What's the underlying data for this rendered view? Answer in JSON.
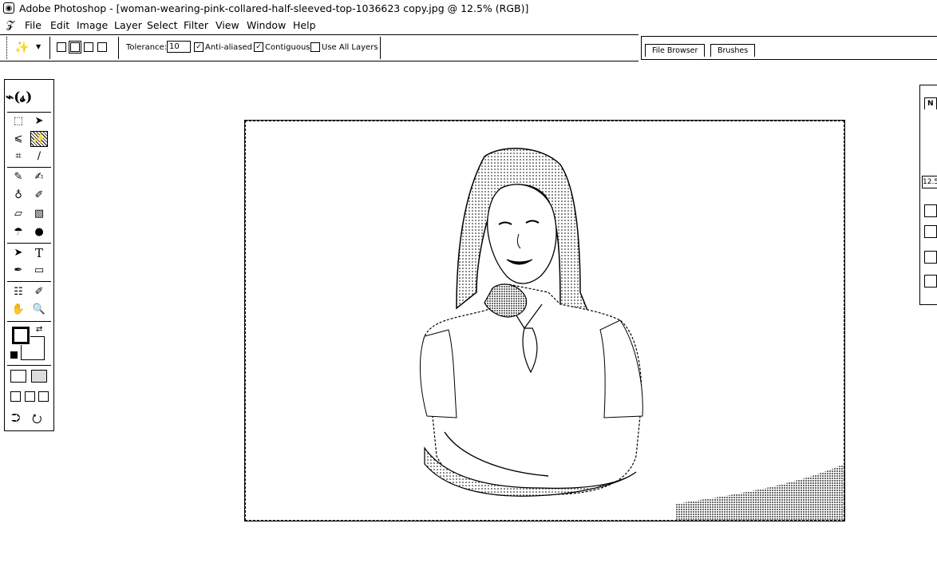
{
  "window": {
    "app_icon": "photoshop-app-icon",
    "title": "Adobe Photoshop - [woman-wearing-pink-collared-half-sleeved-top-1036623 copy.jpg @ 12.5% (RGB)]"
  },
  "menu": {
    "items": [
      "File",
      "Edit",
      "Image",
      "Layer",
      "Select",
      "Filter",
      "View",
      "Window",
      "Help"
    ]
  },
  "options_bar": {
    "tool_icon": "magic-wand-icon",
    "selection_modes": [
      "new-selection-icon",
      "add-to-selection-icon",
      "subtract-from-selection-icon",
      "intersect-selection-icon"
    ],
    "tolerance_label": "Tolerance:",
    "tolerance_value": "10",
    "anti_aliased_label": "Anti-aliased",
    "anti_aliased_checked": true,
    "contiguous_label": "Contiguous",
    "contiguous_checked": true,
    "use_all_layers_label": "Use All Layers",
    "use_all_layers_checked": false
  },
  "palette_well": {
    "tabs": [
      "File Browser",
      "Brushes"
    ]
  },
  "toolbox": {
    "selected_tool": "magic-wand",
    "tools": [
      "rectangular-marquee-icon",
      "move-icon",
      "lasso-icon",
      "magic-wand-icon",
      "crop-icon",
      "slice-icon",
      "healing-brush-icon",
      "brush-icon",
      "clone-stamp-icon",
      "history-brush-icon",
      "eraser-icon",
      "gradient-icon",
      "blur-icon",
      "dodge-icon",
      "path-selection-icon",
      "type-icon",
      "pen-icon",
      "rectangle-shape-icon",
      "notes-icon",
      "eyedropper-icon",
      "hand-icon",
      "zoom-icon"
    ],
    "type_tool_glyph": "T"
  },
  "document": {
    "description_icon": "photo-of-woman-icon"
  },
  "navigator": {
    "tab_label": "N",
    "zoom_value": "12.5"
  }
}
